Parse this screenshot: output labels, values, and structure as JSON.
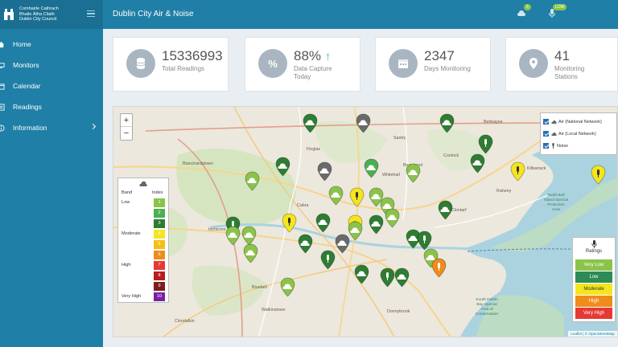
{
  "app": {
    "org_lines": [
      "Comhairle Cathrach",
      "Bhaile Átha Cliath",
      "Dublin City Council"
    ],
    "title": "Dublin City Air & Noise"
  },
  "nav": {
    "items": [
      {
        "label": "Home",
        "icon": "home-icon"
      },
      {
        "label": "Monitors",
        "icon": "monitor-icon"
      },
      {
        "label": "Calendar",
        "icon": "calendar-icon"
      },
      {
        "label": "Readings",
        "icon": "readings-icon"
      },
      {
        "label": "Information",
        "icon": "info-icon"
      }
    ]
  },
  "header": {
    "air_badge": "5",
    "noise_badge": "LOW"
  },
  "stats": [
    {
      "value": "15336993",
      "label": "Total Readings",
      "icon": "database-icon"
    },
    {
      "value": "88%",
      "trend": "↑",
      "label_lines": [
        "Data Capture",
        "Today"
      ],
      "icon": "percent-icon"
    },
    {
      "value": "2347",
      "label": "Days Monitoring",
      "icon": "calendar-icon"
    },
    {
      "value": "41",
      "label_lines": [
        "Monitoring",
        "Stations"
      ],
      "icon": "location-pin-icon"
    }
  ],
  "map": {
    "zoom_in": "+",
    "zoom_out": "−",
    "layers": [
      "Air (National Network)",
      "Air (Local Network)",
      "Noise"
    ],
    "bands_header": {
      "band": "Band",
      "index": "Index"
    },
    "bands": [
      {
        "name": "Low",
        "index": "1",
        "color": "#8bc34a"
      },
      {
        "index": "2",
        "color": "#4caf50"
      },
      {
        "index": "3",
        "color": "#2e7d32"
      },
      {
        "name": "Moderate",
        "index": "4",
        "color": "#f4e51e"
      },
      {
        "index": "5",
        "color": "#f5c016"
      },
      {
        "index": "6",
        "color": "#ef8c1a"
      },
      {
        "name": "High",
        "index": "7",
        "color": "#e53935"
      },
      {
        "index": "8",
        "color": "#b71c1c"
      },
      {
        "index": "9",
        "color": "#7b1d1d"
      },
      {
        "name": "Very High",
        "index": "10",
        "color": "#7b1fa2"
      }
    ],
    "ratings_title": "Ratings",
    "ratings": [
      {
        "label": "Very Low",
        "color": "#8bc34a"
      },
      {
        "label": "Low",
        "color": "#2e8b57"
      },
      {
        "label": "Moderate",
        "color": "#f4e51e"
      },
      {
        "label": "High",
        "color": "#ef8c1a"
      },
      {
        "label": "Very High",
        "color": "#e53935"
      }
    ],
    "places": [
      "Finglas",
      "Blanchardstown",
      "Santry",
      "Coolock",
      "Beaumont",
      "Whitehall",
      "Cabra",
      "Clondalkin",
      "Bluebell",
      "Walkinstown",
      "Donnybrook",
      "Belmayne",
      "Kilbarrack",
      "Raheny",
      "Clontarf",
      "Inchicore"
    ],
    "areas": [
      {
        "lines": [
          "North Bull",
          "Island Special",
          "Protection",
          "Area"
        ]
      },
      {
        "lines": [
          "South Dublin",
          "Bay Special",
          "Area of",
          "Conservation"
        ]
      }
    ],
    "attribution": "Leaflet | © OpenStreetMap"
  }
}
